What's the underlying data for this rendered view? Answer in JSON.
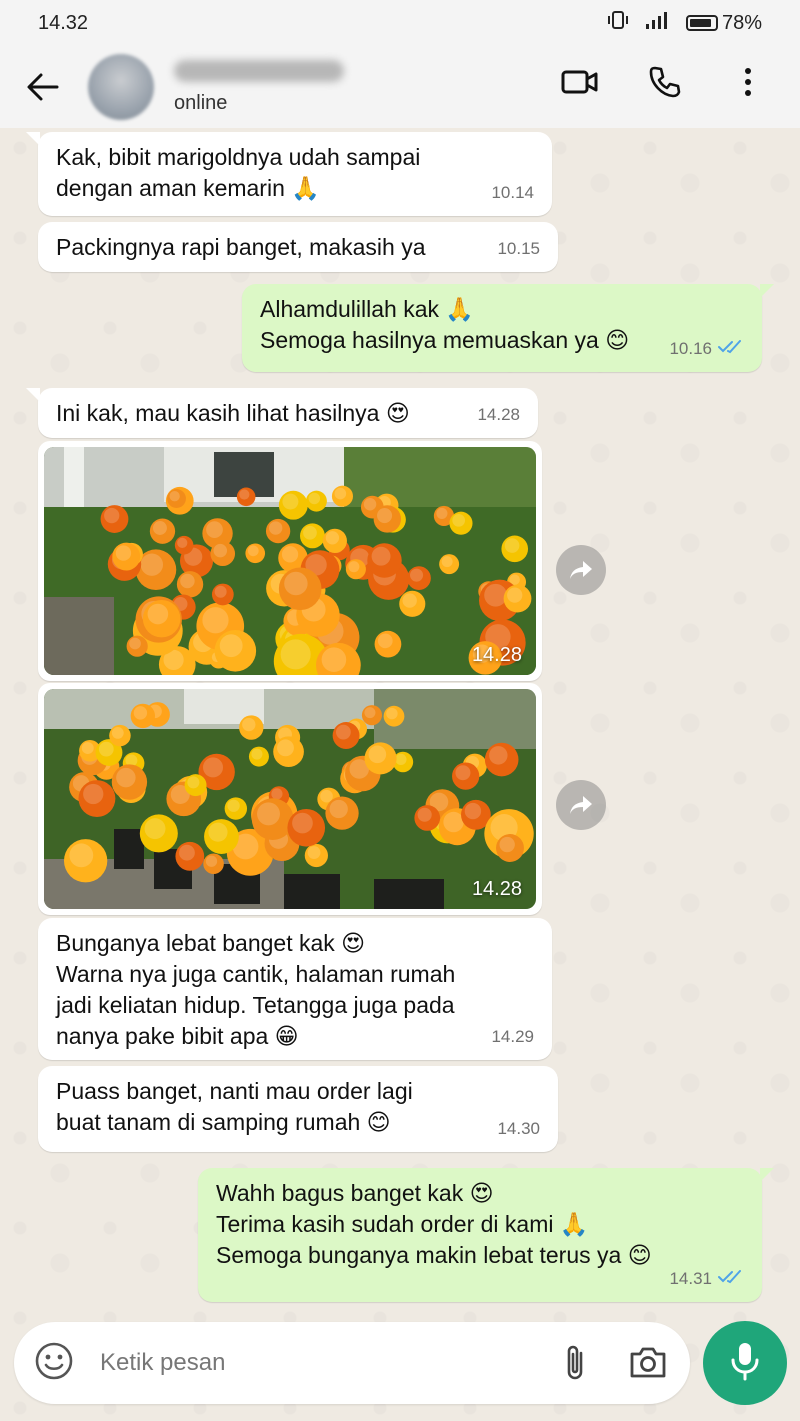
{
  "status_bar": {
    "time": "14.32",
    "battery": "78%"
  },
  "header": {
    "status": "online"
  },
  "messages": [
    {
      "lines": [
        "Kak, bibit marigoldnya udah sampai",
        "dengan aman kemarin"
      ],
      "time": "10.14"
    },
    {
      "lines": [
        "Packingnya rapi banget, makasih ya"
      ],
      "time": "10.15"
    },
    {
      "lines": [
        "Alhamdulillah kak",
        "Semoga hasilnya memuaskan ya"
      ],
      "time": "10.16"
    },
    {
      "lines": [
        "Ini kak, mau kasih lihat hasilnya"
      ],
      "time": "14.28"
    },
    {
      "lines": [
        "Bunganya lebat banget kak",
        "Warna nya juga cantik, halaman rumah",
        "jadi keliatan hidup. Tetangga juga pada",
        "nanya pake bibit apa"
      ],
      "time": "14.29"
    },
    {
      "lines": [
        "Puass banget, nanti mau order lagi",
        "buat tanam di samping rumah"
      ],
      "time": "14.30"
    },
    {
      "lines": [
        "Wahh bagus banget kak",
        "Terima kasih sudah order di kami",
        "Semoga bunganya makin lebat terus ya"
      ],
      "time": "14.31"
    }
  ],
  "photos": [
    {
      "time": "14.28"
    },
    {
      "time": "14.28"
    }
  ],
  "composer": {
    "placeholder": "Ketik pesan"
  },
  "colors": {
    "outgoing": "#dcf8c6",
    "incoming": "#ffffff",
    "accent": "#1fa67a",
    "read_tick": "#4fa3e8"
  }
}
